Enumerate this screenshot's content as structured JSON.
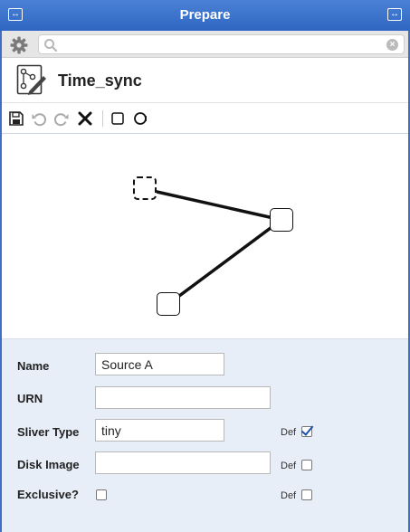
{
  "window": {
    "title": "Prepare"
  },
  "search": {
    "value": "",
    "placeholder": ""
  },
  "header": {
    "title": "Time_sync"
  },
  "toolbar": {
    "icons": [
      "save-icon",
      "undo-icon",
      "redo-icon",
      "delete-icon",
      "square-node-icon",
      "circle-node-icon"
    ]
  },
  "form": {
    "name_label": "Name",
    "name_value": "Source A",
    "urn_label": "URN",
    "urn_value": "",
    "sliver_type_label": "Sliver Type",
    "sliver_type_value": "tiny",
    "sliver_type_default": "Def",
    "sliver_type_default_checked": true,
    "disk_image_label": "Disk Image",
    "disk_image_value": "",
    "disk_image_default": "Def",
    "disk_image_default_checked": false,
    "exclusive_label": "Exclusive?",
    "exclusive_checked": false,
    "exclusive_default": "Def",
    "exclusive_default_checked": false
  },
  "colors": {
    "titlebar": "#3a72cc",
    "form_background": "#e8eef8",
    "checkmark": "#1b4fa8"
  }
}
